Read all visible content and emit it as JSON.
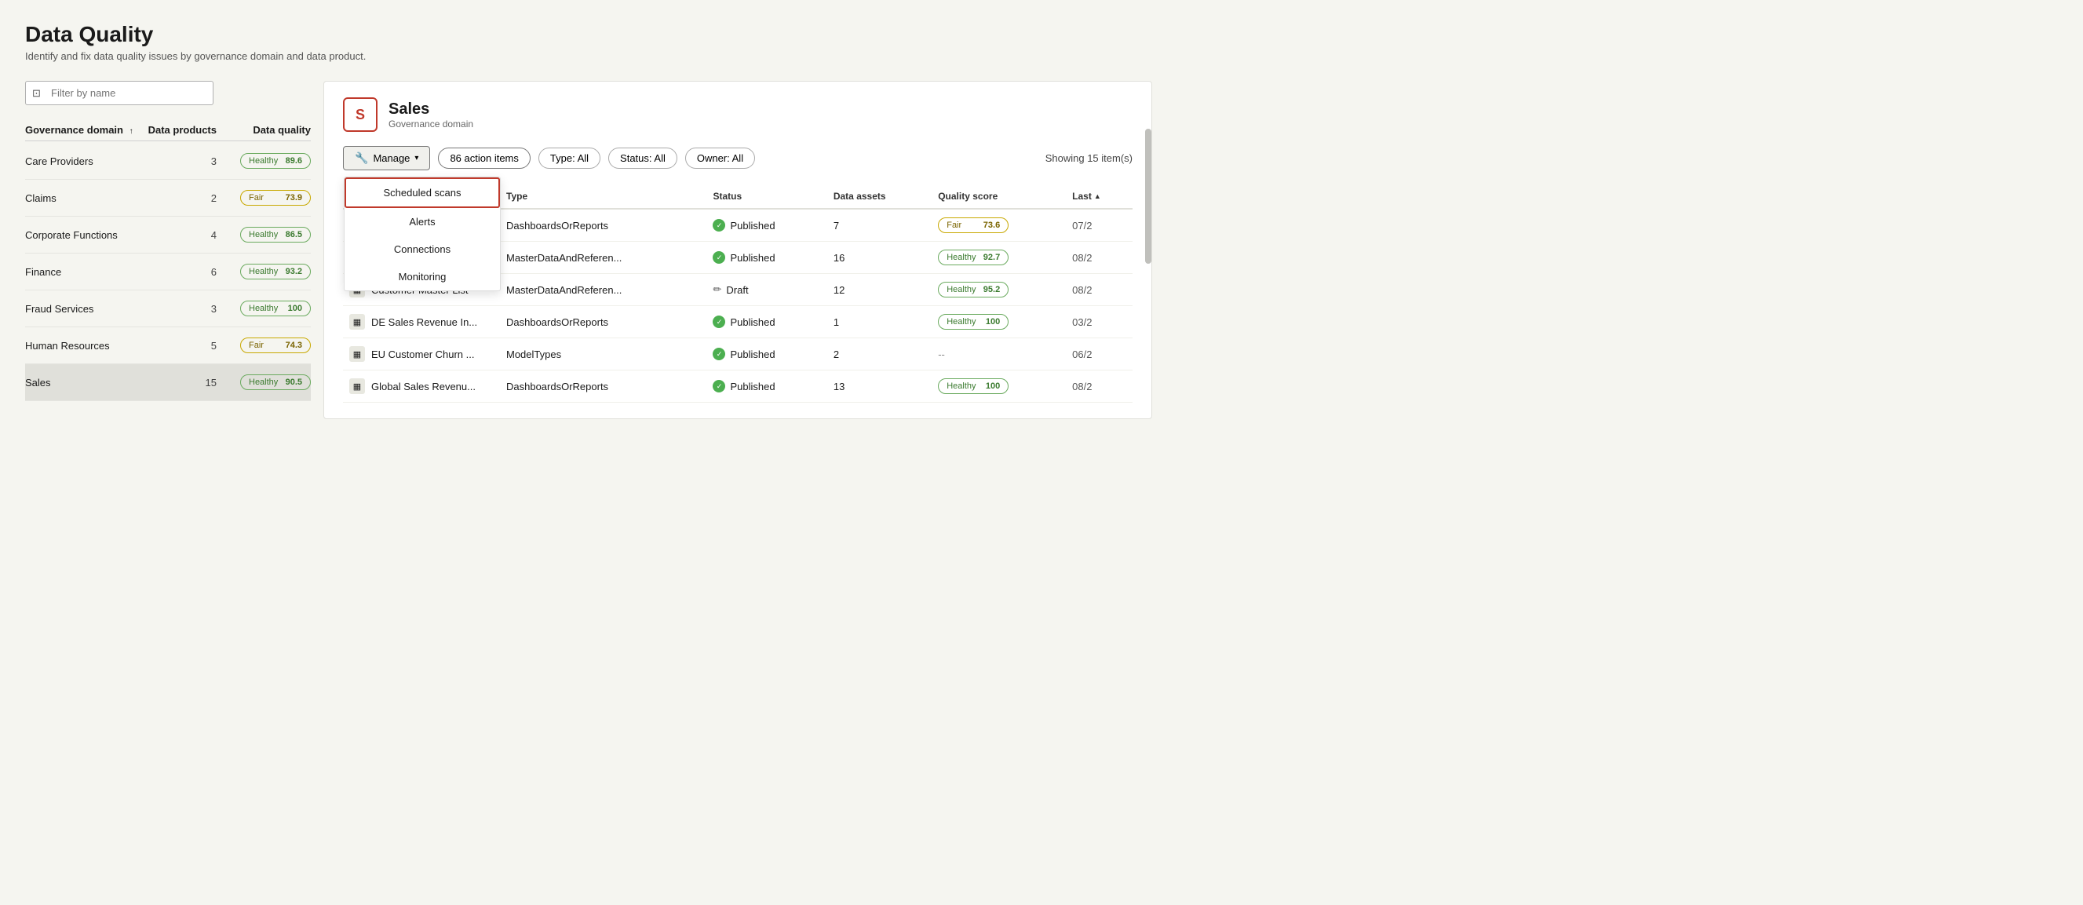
{
  "page": {
    "title": "Data Quality",
    "subtitle": "Identify and fix data quality issues by governance domain and data product."
  },
  "filter": {
    "placeholder": "Filter by name"
  },
  "left_table": {
    "col_domain": "Governance domain",
    "col_products": "Data products",
    "col_quality": "Data quality",
    "rows": [
      {
        "name": "Care Providers",
        "products": 3,
        "quality_label": "Healthy",
        "quality_score": "89.6",
        "badge_type": "healthy"
      },
      {
        "name": "Claims",
        "products": 2,
        "quality_label": "Fair",
        "quality_score": "73.9",
        "badge_type": "fair"
      },
      {
        "name": "Corporate Functions",
        "products": 4,
        "quality_label": "Healthy",
        "quality_score": "86.5",
        "badge_type": "healthy"
      },
      {
        "name": "Finance",
        "products": 6,
        "quality_label": "Healthy",
        "quality_score": "93.2",
        "badge_type": "healthy"
      },
      {
        "name": "Fraud Services",
        "products": 3,
        "quality_label": "Healthy",
        "quality_score": "100",
        "badge_type": "healthy"
      },
      {
        "name": "Human Resources",
        "products": 5,
        "quality_label": "Fair",
        "quality_score": "74.3",
        "badge_type": "fair"
      },
      {
        "name": "Sales",
        "products": 15,
        "quality_label": "Healthy",
        "quality_score": "90.5",
        "badge_type": "healthy"
      }
    ]
  },
  "right_panel": {
    "domain_letter": "S",
    "domain_title": "Sales",
    "domain_type": "Governance domain",
    "manage_label": "Manage",
    "action_items_label": "86 action items",
    "filter_type_label": "Type: All",
    "filter_status_label": "Status: All",
    "filter_owner_label": "Owner: All",
    "showing_label": "Showing 15 item(s)",
    "dropdown": {
      "items": [
        {
          "label": "Scheduled scans",
          "highlighted": true
        },
        {
          "label": "Alerts",
          "highlighted": false
        },
        {
          "label": "Connections",
          "highlighted": false
        },
        {
          "label": "Monitoring",
          "highlighted": false
        }
      ]
    },
    "table": {
      "columns": [
        "",
        "Type",
        "Status",
        "Data assets",
        "Quality score",
        "Last"
      ],
      "rows": [
        {
          "name": "",
          "type": "DashboardsOrReports",
          "status": "Published",
          "status_type": "published",
          "data_assets": 7,
          "quality_label": "Fair",
          "quality_score": "73.6",
          "badge_type": "fair",
          "last": "07/2"
        },
        {
          "name": "",
          "type": "MasterDataAndReferen...",
          "status": "Published",
          "status_type": "published",
          "data_assets": 16,
          "quality_label": "Healthy",
          "quality_score": "92.7",
          "badge_type": "healthy",
          "last": "08/2"
        },
        {
          "name": "Customer Master List",
          "type": "MasterDataAndReferen...",
          "status": "Draft",
          "status_type": "draft",
          "data_assets": 12,
          "quality_label": "Healthy",
          "quality_score": "95.2",
          "badge_type": "healthy",
          "last": "08/2"
        },
        {
          "name": "DE Sales Revenue In...",
          "type": "DashboardsOrReports",
          "status": "Published",
          "status_type": "published",
          "data_assets": 1,
          "quality_label": "Healthy",
          "quality_score": "100",
          "badge_type": "healthy",
          "last": "03/2"
        },
        {
          "name": "EU Customer Churn ...",
          "type": "ModelTypes",
          "status": "Published",
          "status_type": "published",
          "data_assets": 2,
          "quality_label": "--",
          "quality_score": "",
          "badge_type": "none",
          "last": "06/2"
        },
        {
          "name": "Global Sales Revenu...",
          "type": "DashboardsOrReports",
          "status": "Published",
          "status_type": "published",
          "data_assets": 13,
          "quality_label": "Healthy",
          "quality_score": "100",
          "badge_type": "healthy",
          "last": "08/2"
        }
      ]
    }
  }
}
